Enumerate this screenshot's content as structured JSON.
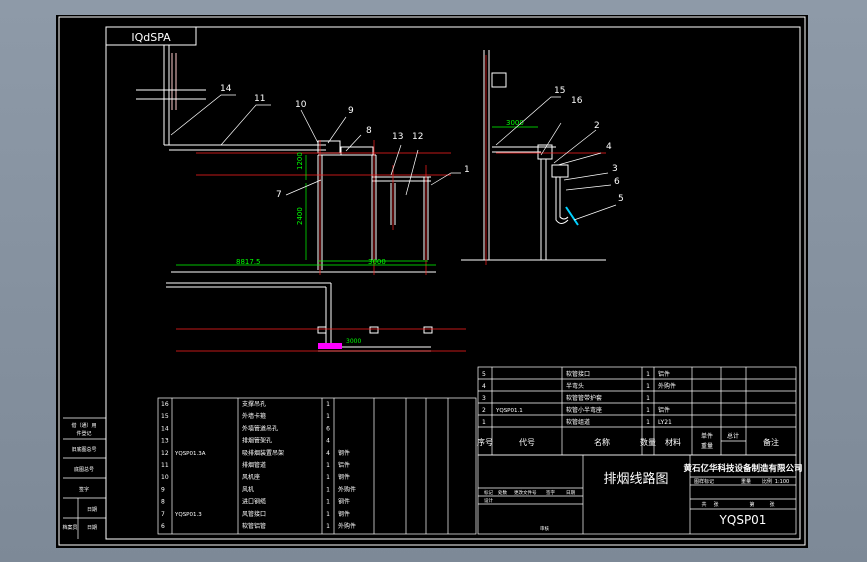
{
  "drawing": {
    "code_box": "IQdSPA",
    "title": "排烟线路图",
    "company": "黄石亿华科技设备制造有限公司",
    "drawing_number": "YQSP01",
    "scale": "1:100",
    "dim_width": "3000",
    "dim_plan": "3000",
    "dim_height_1": "1200",
    "dim_height_2": "2400",
    "dim_left": "8817.5",
    "dim_base": "3000"
  },
  "callouts": [
    "1",
    "2",
    "3",
    "4",
    "5",
    "6",
    "7",
    "8",
    "9",
    "10",
    "11",
    "12",
    "13",
    "14",
    "15",
    "16"
  ],
  "bom_right": {
    "headers": [
      "序号",
      "代号",
      "名称",
      "数量",
      "材料",
      "单件",
      "总计",
      "备注"
    ],
    "weight_headers": [
      "单件",
      "总计"
    ],
    "weight_label": "重量",
    "rows": [
      {
        "no": "5",
        "code": "",
        "name": "软管接口",
        "qty": "1",
        "note": "铝件"
      },
      {
        "no": "4",
        "code": "",
        "name": "半弯头",
        "qty": "1",
        "note": "外购件"
      },
      {
        "no": "3",
        "code": "",
        "name": "软管管带护套",
        "qty": "1",
        "note": ""
      },
      {
        "no": "2",
        "code": "YQSP01.1",
        "name": "软管小半弯座",
        "qty": "1",
        "note": "铝件"
      },
      {
        "no": "1",
        "code": "",
        "name": "软管组道",
        "qty": "1",
        "note": "LY21"
      }
    ]
  },
  "bom_left": {
    "rows": [
      {
        "no": "16",
        "code": "",
        "name": "支撑吊孔",
        "qty": "1",
        "mat": ""
      },
      {
        "no": "15",
        "code": "",
        "name": "外墙卡箍",
        "qty": "1",
        "mat": ""
      },
      {
        "no": "14",
        "code": "",
        "name": "外墙管道吊孔",
        "qty": "6",
        "mat": ""
      },
      {
        "no": "13",
        "code": "",
        "name": "排烟管架孔",
        "qty": "4",
        "mat": ""
      },
      {
        "no": "12",
        "code": "YQSP01.3A",
        "name": "吸排烟装置吊架",
        "qty": "4",
        "mat": "钢件"
      },
      {
        "no": "11",
        "code": "",
        "name": "排烟管道",
        "qty": "1",
        "mat": "铝件"
      },
      {
        "no": "10",
        "code": "",
        "name": "风机座",
        "qty": "1",
        "mat": "钢件"
      },
      {
        "no": "9",
        "code": "",
        "name": "风机",
        "qty": "1",
        "mat": "外购件"
      },
      {
        "no": "8",
        "code": "",
        "name": "进口钢缆",
        "qty": "1",
        "mat": "钢件"
      },
      {
        "no": "7",
        "code": "YQSP01.3",
        "name": "风管接口",
        "qty": "1",
        "mat": "钢件"
      },
      {
        "no": "6",
        "code": "",
        "name": "软管铝管",
        "qty": "1",
        "mat": "外购件"
      }
    ]
  },
  "side_labels": [
    "借（通）用",
    "件登记",
    "旧底图总号",
    "底图总号",
    "签字",
    "日期",
    "档案员",
    "日期"
  ],
  "title_cells": {
    "stage": "图样标记",
    "weight": "重量",
    "scale_label": "比例",
    "sheets": "共",
    "sheet": "张",
    "sheet_no": "第",
    "sheet_no_suffix": "张",
    "mark": "标记",
    "count": "处数",
    "change_doc": "更改文件号",
    "sign": "签字",
    "date": "日期",
    "designer": "设计",
    "checker": "审核"
  },
  "colors": {
    "line": "#ffffff",
    "dimension": "#00ff00",
    "axis": "#ff2020",
    "accent": "#ff00ff",
    "fitting": "#00d0ff",
    "text": "#ffffff"
  }
}
